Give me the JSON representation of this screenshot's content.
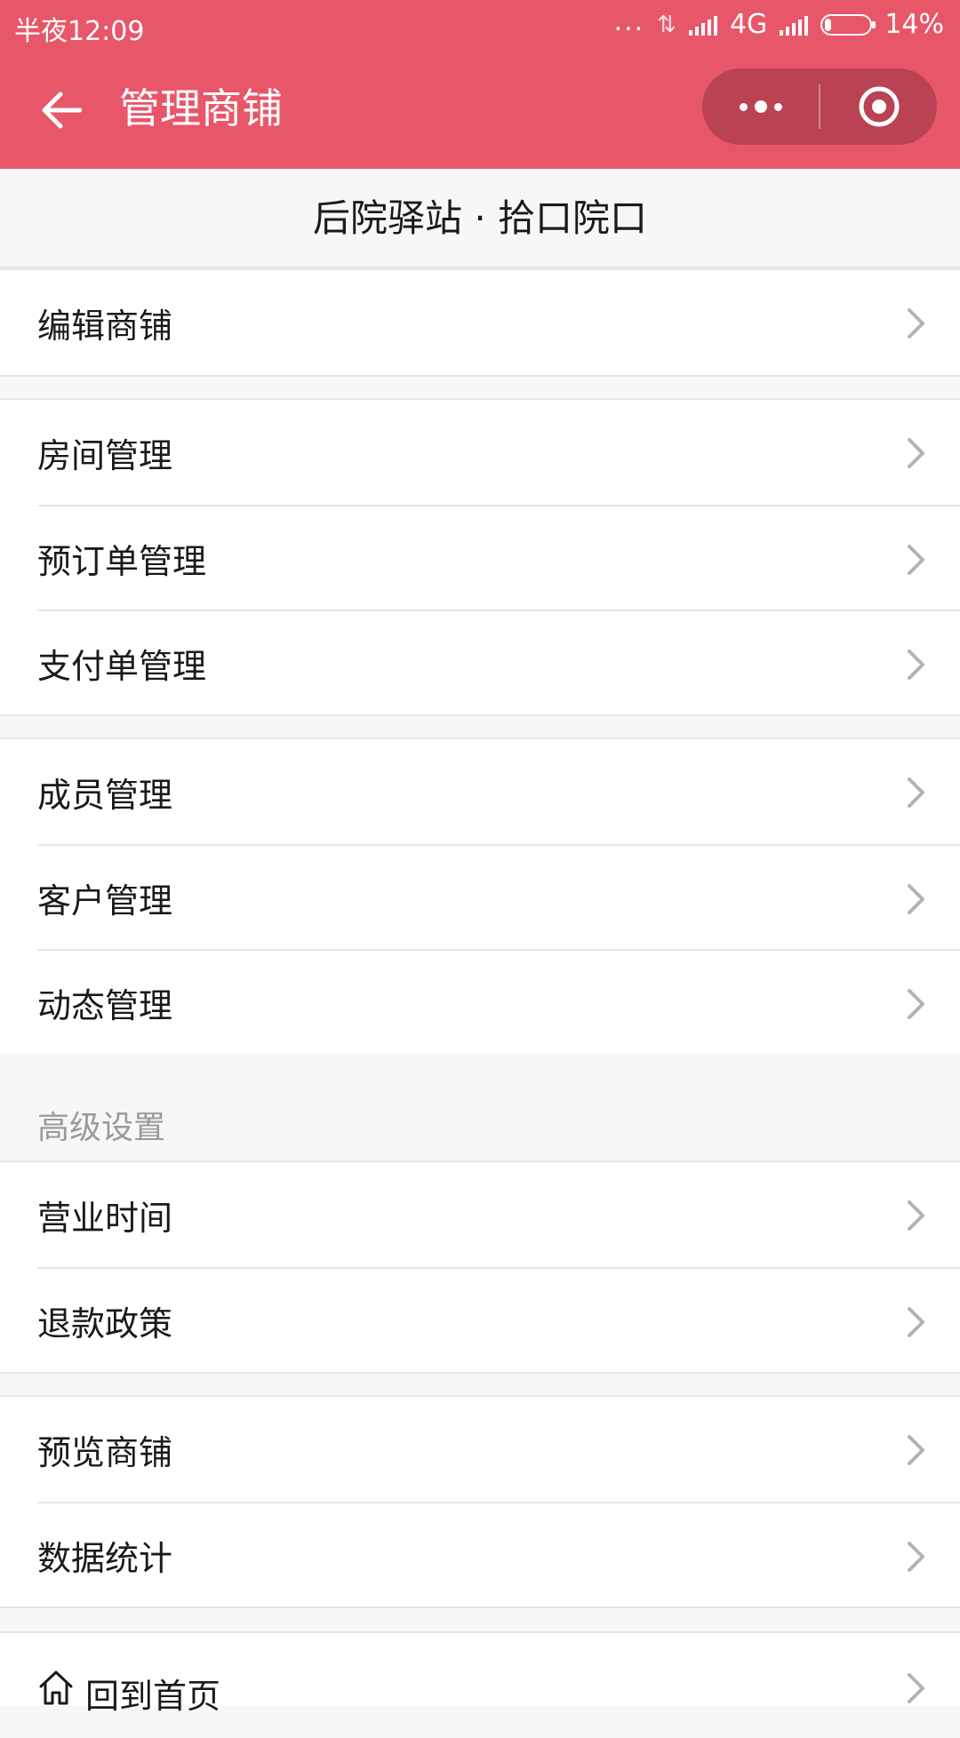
{
  "status_bar": {
    "time": "半夜12:09",
    "dots": "...",
    "network": "4G",
    "battery": "14%",
    "battery_level": 0.14
  },
  "nav": {
    "title": "管理商铺",
    "back_icon": "arrow-left-icon",
    "more_icon": "more-dots-icon",
    "close_icon": "target-close-icon"
  },
  "shop": {
    "name": "后院驿站 · 拾口院口"
  },
  "groups": [
    {
      "items": [
        {
          "label": "编辑商铺"
        }
      ]
    },
    {
      "items": [
        {
          "label": "房间管理"
        },
        {
          "label": "预订单管理"
        },
        {
          "label": "支付单管理"
        }
      ]
    },
    {
      "items": [
        {
          "label": "成员管理"
        },
        {
          "label": "客户管理"
        },
        {
          "label": "动态管理"
        }
      ]
    },
    {
      "header": "高级设置",
      "items": [
        {
          "label": "营业时间"
        },
        {
          "label": "退款政策"
        }
      ]
    },
    {
      "items": [
        {
          "label": "预览商铺"
        },
        {
          "label": "数据统计"
        }
      ]
    },
    {
      "items": [
        {
          "label": "回到首页",
          "icon": "home-icon"
        }
      ]
    }
  ],
  "colors": {
    "header_bg": "#e8566a",
    "capsule_bg": "#b94253",
    "page_bg": "#f7f7f7",
    "chevron": "#b3b3b3",
    "section_header_text": "#9a9a9a"
  }
}
